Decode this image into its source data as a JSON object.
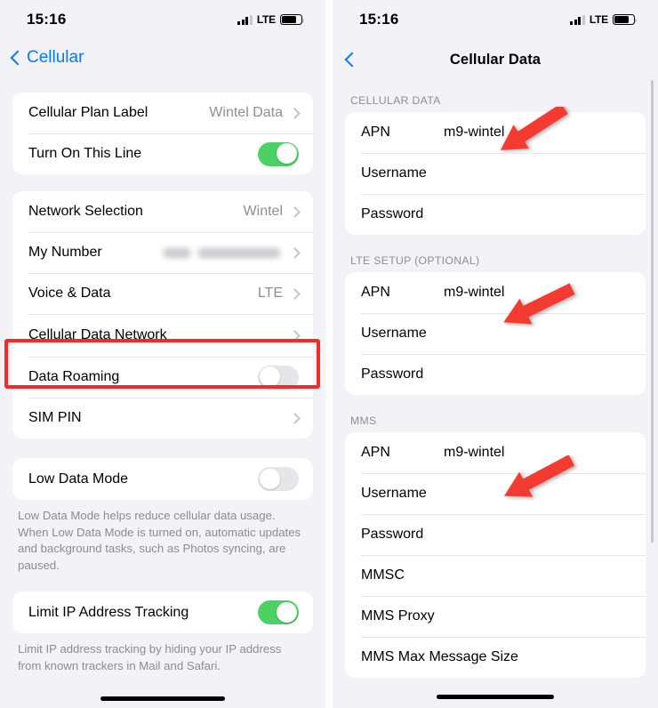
{
  "left_screen": {
    "status_bar": {
      "time": "15:16",
      "network_label": "LTE",
      "signal_icon": "cellular-signal-icon",
      "battery_icon": "battery-icon"
    },
    "nav": {
      "back_label": "Cellular",
      "back_icon": "chevron-left-icon"
    },
    "groups": [
      {
        "rows": [
          {
            "label": "Cellular Plan Label",
            "value": "Wintel Data",
            "accessory": "chevron"
          },
          {
            "label": "Turn On This Line",
            "value": "",
            "accessory": "toggle-on"
          }
        ]
      },
      {
        "rows": [
          {
            "label": "Network Selection",
            "value": "Wintel",
            "accessory": "chevron"
          },
          {
            "label": "My Number",
            "value": "",
            "accessory": "chevron-blurred"
          },
          {
            "label": "Voice & Data",
            "value": "LTE",
            "accessory": "chevron"
          },
          {
            "label": "Cellular Data Network",
            "value": "",
            "accessory": "chevron"
          },
          {
            "label": "Data Roaming",
            "value": "",
            "accessory": "toggle-off"
          },
          {
            "label": "SIM PIN",
            "value": "",
            "accessory": "chevron"
          }
        ]
      },
      {
        "rows": [
          {
            "label": "Low Data Mode",
            "value": "",
            "accessory": "toggle-off"
          }
        ],
        "footnote": "Low Data Mode helps reduce cellular data usage. When Low Data Mode is turned on, automatic updates and background tasks, such as Photos syncing, are paused."
      },
      {
        "rows": [
          {
            "label": "Limit IP Address Tracking",
            "value": "",
            "accessory": "toggle-on"
          }
        ],
        "footnote": "Limit IP address tracking by hiding your IP address from known trackers in Mail and Safari."
      }
    ]
  },
  "right_screen": {
    "status_bar": {
      "time": "15:16",
      "network_label": "LTE",
      "signal_icon": "cellular-signal-icon",
      "battery_icon": "battery-icon"
    },
    "nav": {
      "title": "Cellular Data",
      "back_icon": "chevron-left-icon"
    },
    "sections": [
      {
        "header": "CELLULAR DATA",
        "rows": [
          {
            "label": "APN",
            "value": "m9-wintel"
          },
          {
            "label": "Username",
            "value": ""
          },
          {
            "label": "Password",
            "value": ""
          }
        ]
      },
      {
        "header": "LTE SETUP (OPTIONAL)",
        "rows": [
          {
            "label": "APN",
            "value": "m9-wintel"
          },
          {
            "label": "Username",
            "value": ""
          },
          {
            "label": "Password",
            "value": ""
          }
        ]
      },
      {
        "header": "MMS",
        "rows": [
          {
            "label": "APN",
            "value": "m9-wintel"
          },
          {
            "label": "Username",
            "value": ""
          },
          {
            "label": "Password",
            "value": ""
          },
          {
            "label": "MMSC",
            "value": ""
          },
          {
            "label": "MMS Proxy",
            "value": ""
          },
          {
            "label": "MMS Max Message Size",
            "value": ""
          }
        ]
      }
    ]
  },
  "annotations": {
    "highlight_color": "#f22b28",
    "arrow_color": "#f43a32",
    "highlight_target": "Cellular Data Network",
    "arrow_targets": [
      "APN",
      "APN",
      "APN"
    ]
  }
}
